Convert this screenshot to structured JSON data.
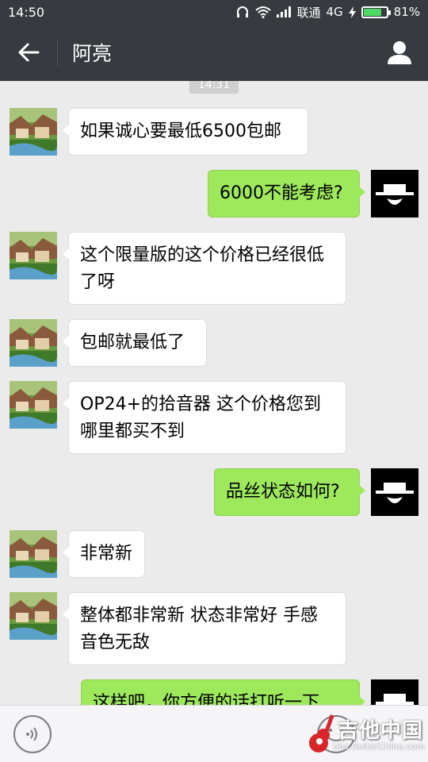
{
  "status_bar": {
    "time": "14:50",
    "carrier": "联通",
    "network": "4G",
    "battery": "81%",
    "battery_level": 0.81
  },
  "header": {
    "title": "阿亮",
    "back_icon": "back-arrow-icon",
    "profile_icon": "person-icon"
  },
  "chat": {
    "timestamp": "14:31",
    "messages": [
      {
        "side": "in",
        "text": "如果诚心要最低6500包邮"
      },
      {
        "side": "out",
        "text": "6000不能考虑?"
      },
      {
        "side": "in",
        "text": "这个限量版的这个价格已经很低了呀"
      },
      {
        "side": "in",
        "text": "包邮就最低了"
      },
      {
        "side": "in",
        "text": "OP24+的拾音器 这个价格您到哪里都买不到"
      },
      {
        "side": "out",
        "text": "品丝状态如何?"
      },
      {
        "side": "in",
        "text": "非常新"
      },
      {
        "side": "in",
        "text": "整体都非常新 状态非常好 手感音色无敌"
      },
      {
        "side": "out",
        "text": "这样吧，你方便的话打听一下"
      }
    ]
  },
  "input_bar": {
    "voice_icon": "voice-icon",
    "emoji_icon": "emoji-icon"
  },
  "watermark": {
    "title": "吉他中国",
    "subtitle": "bbs.GuitarChina.com"
  },
  "colors": {
    "header_bg": "#393a3f",
    "chat_bg": "#ebebeb",
    "outgoing_bubble": "#9ee85c",
    "incoming_bubble": "#ffffff"
  }
}
